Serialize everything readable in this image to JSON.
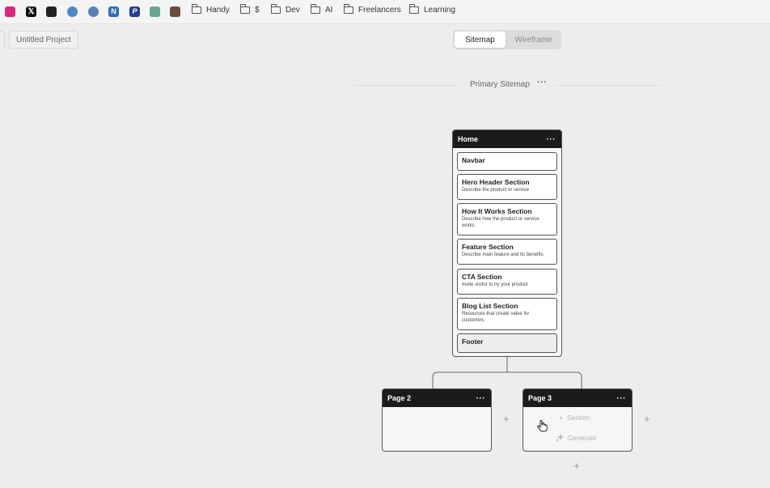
{
  "bookmarks": {
    "icons": [
      {
        "name": "instagram",
        "glyph": "",
        "color": "#d6297a"
      },
      {
        "name": "x",
        "glyph": "𝕏",
        "color": "#111111"
      },
      {
        "name": "trello",
        "glyph": "",
        "color": "#222222"
      },
      {
        "name": "globe",
        "glyph": "",
        "color": "#4a88c7"
      },
      {
        "name": "link",
        "glyph": "",
        "color": "#5b7fb5"
      },
      {
        "name": "notion-n",
        "glyph": "N",
        "color": "#2f6fb0"
      },
      {
        "name": "paypal",
        "glyph": "P",
        "color": "#243f8f"
      },
      {
        "name": "chatgpt",
        "glyph": "",
        "color": "#6aa391"
      },
      {
        "name": "profile-photo",
        "glyph": "",
        "color": "#6b4b3b"
      }
    ],
    "folders": [
      "Handy",
      "$",
      "Dev",
      "AI",
      "Freelancers",
      "Learning"
    ]
  },
  "project": {
    "name": "Untitled Project"
  },
  "view_toggle": {
    "active": "Sitemap",
    "inactive": "Wireframe"
  },
  "sitemap": {
    "title": "Primary Sitemap",
    "menu": "···"
  },
  "home": {
    "title": "Home",
    "menu": "···",
    "sections": [
      {
        "title": "Navbar",
        "desc": ""
      },
      {
        "title": "Hero Header Section",
        "desc": "Describe the product or service"
      },
      {
        "title": "How It Works Section",
        "desc": "Describe how the product or service works"
      },
      {
        "title": "Feature Section",
        "desc": "Describe main feature and its benefits"
      },
      {
        "title": "CTA Section",
        "desc": "Invite visitor to try your product"
      },
      {
        "title": "Blog List Section",
        "desc": "Resources that create value for customers"
      },
      {
        "title": "Footer",
        "desc": ""
      }
    ]
  },
  "page2": {
    "title": "Page 2",
    "menu": "···"
  },
  "page3": {
    "title": "Page 3",
    "menu": "···",
    "add_section": "Section",
    "generate": "Generate"
  },
  "plus": "+"
}
